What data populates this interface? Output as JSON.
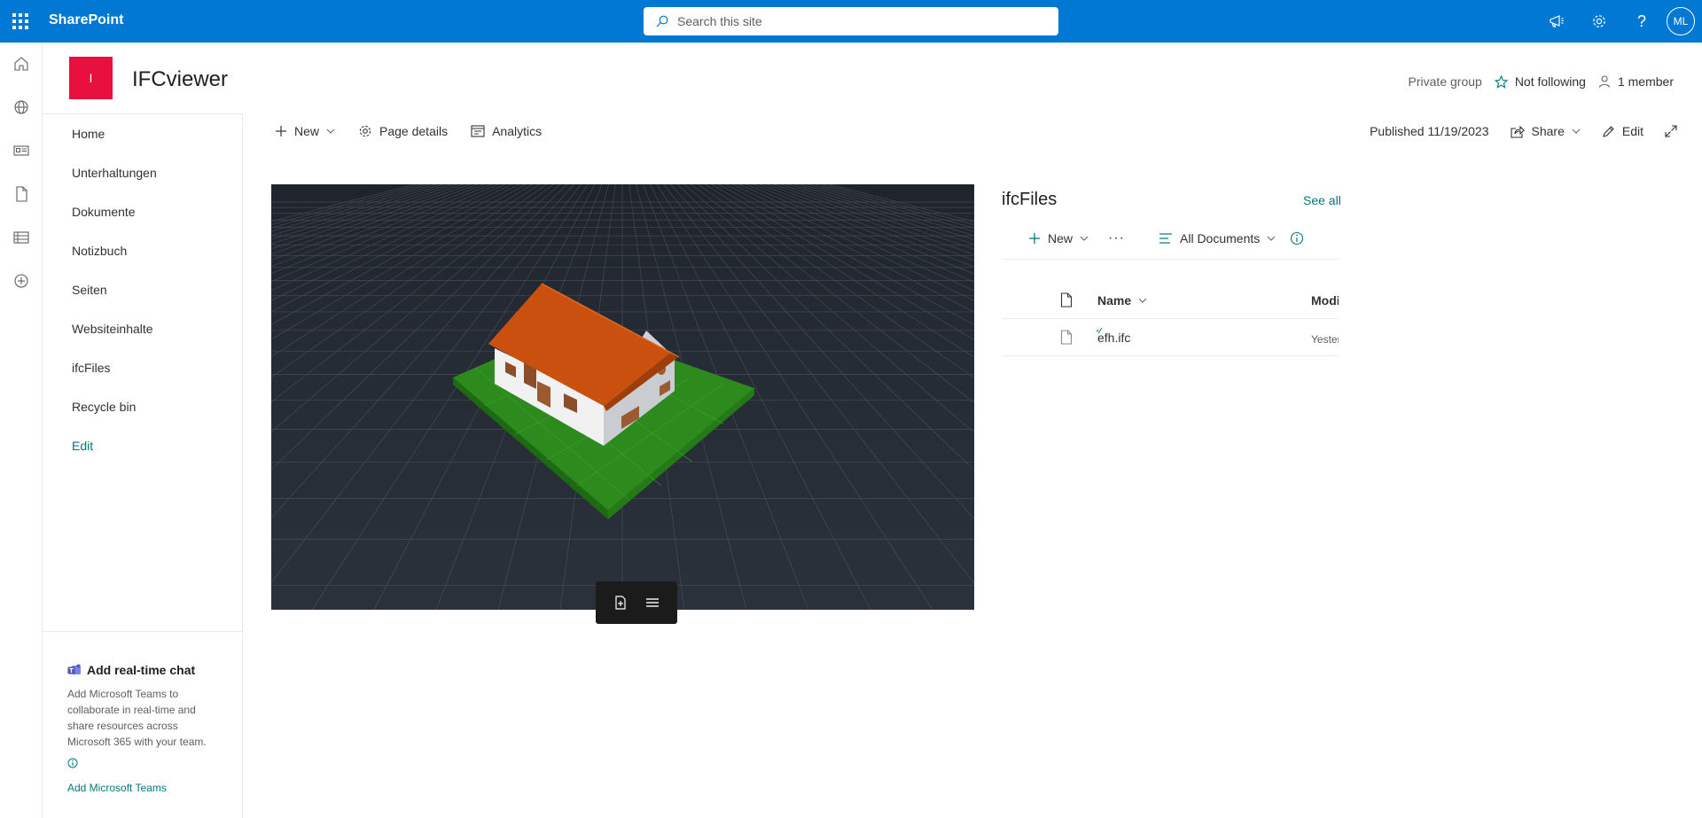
{
  "suite": {
    "brand": "SharePoint",
    "search_placeholder": "Search this site",
    "avatar_initials": "ML"
  },
  "site": {
    "logo_letter": "I",
    "title": "IFCviewer",
    "privacy": "Private group",
    "follow": "Not following",
    "members": "1 member"
  },
  "nav": {
    "items": [
      "Home",
      "Unterhaltungen",
      "Dokumente",
      "Notizbuch",
      "Seiten",
      "Websiteinhalte",
      "ifcFiles",
      "Recycle bin"
    ],
    "edit": "Edit"
  },
  "chat": {
    "title": "Add real-time chat",
    "description": "Add Microsoft Teams to collaborate in real-time and share resources across Microsoft 365 with your team.",
    "link": "Add Microsoft Teams"
  },
  "commandbar": {
    "new": "New",
    "page_details": "Page details",
    "analytics": "Analytics",
    "published": "Published 11/19/2023",
    "share": "Share",
    "edit": "Edit"
  },
  "library": {
    "title": "ifcFiles",
    "see_all": "See all",
    "new": "New",
    "view": "All Documents",
    "columns": {
      "name": "Name",
      "modified": "Modi"
    },
    "rows": [
      {
        "name": "efh.ifc",
        "modified": "Yester"
      }
    ]
  },
  "colors": {
    "suitebar": "#0078d4",
    "site_logo": "#e8103f",
    "accent": "#03787c",
    "viewer_bg": "#262c35",
    "roof": "#c9500e",
    "ground": "#2d8b1e"
  }
}
